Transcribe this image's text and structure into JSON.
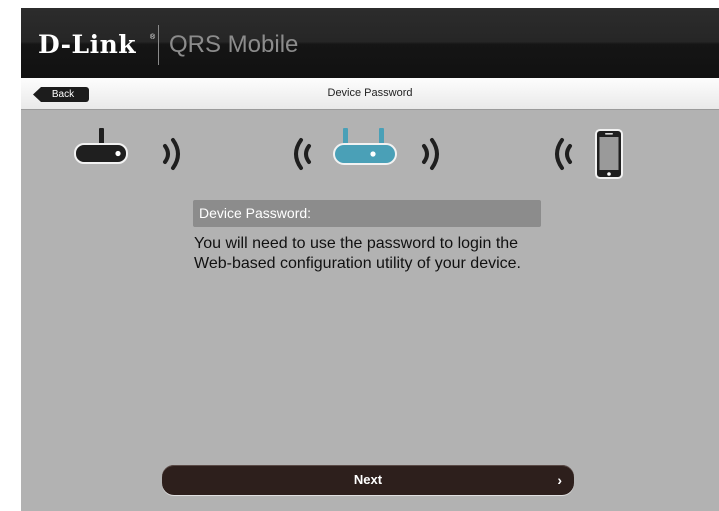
{
  "header": {
    "brand": "D-Link",
    "brand_mark": "®",
    "app_name": "QRS Mobile"
  },
  "navbar": {
    "back_label": "Back",
    "title": "Device Password"
  },
  "diagram": {
    "icons": [
      "modem-icon",
      "wifi-waves-icon",
      "router-icon",
      "smartphone-icon"
    ],
    "accent_color": "#4aa0b7"
  },
  "content": {
    "section_title": "Device Password:",
    "description": "You will need to use the password to login the Web-based configuration utility of your device."
  },
  "footer": {
    "next_label": "Next",
    "next_chevron": "›"
  }
}
